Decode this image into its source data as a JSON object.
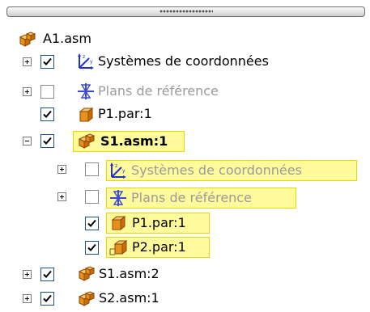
{
  "tree": {
    "root": {
      "label": "A1.asm",
      "icon": "assembly-icon"
    },
    "rows": [
      {
        "label": "Systèmes de coordonnées",
        "icon": "coordinate-system-icon",
        "checked": true
      },
      {
        "label": "Plans de référence",
        "icon": "reference-plane-icon",
        "checked": false
      },
      {
        "label": "P1.par:1",
        "icon": "part-icon",
        "checked": true
      },
      {
        "label": "S1.asm:1",
        "icon": "assembly-icon",
        "checked": true
      },
      {
        "label": "Systèmes de coordonnées",
        "icon": "coordinate-system-icon",
        "checked": false
      },
      {
        "label": "Plans de référence",
        "icon": "reference-plane-icon",
        "checked": false
      },
      {
        "label": "P1.par:1",
        "icon": "part-icon",
        "checked": true
      },
      {
        "label": "P2.par:1",
        "icon": "part-icon",
        "checked": true
      },
      {
        "label": "S1.asm:2",
        "icon": "assembly-icon",
        "checked": true
      },
      {
        "label": "S2.asm:1",
        "icon": "assembly-icon",
        "checked": true
      }
    ]
  },
  "colors": {
    "highlight": "#fffa9c",
    "highlight_border": "#e6d800",
    "part_orange": "#e8901c",
    "coord_blue": "#2233cc"
  }
}
